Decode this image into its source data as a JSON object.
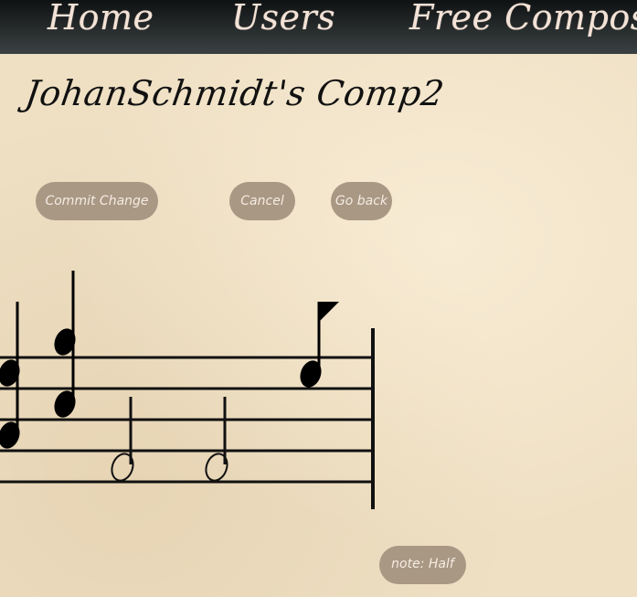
{
  "nav": {
    "home": "Home",
    "users": "Users",
    "free_compose": "Free Compose"
  },
  "composition_title": "JohanSchmidt's Comp2",
  "buttons": {
    "commit": "Commit Change",
    "cancel": "Cancel",
    "go_back": "Go back"
  },
  "note_selector": "note: Half",
  "colors": {
    "navbar": "#2e3334",
    "button": "#a99884",
    "nav_text": "#f3e2d6",
    "ink": "#111111"
  }
}
